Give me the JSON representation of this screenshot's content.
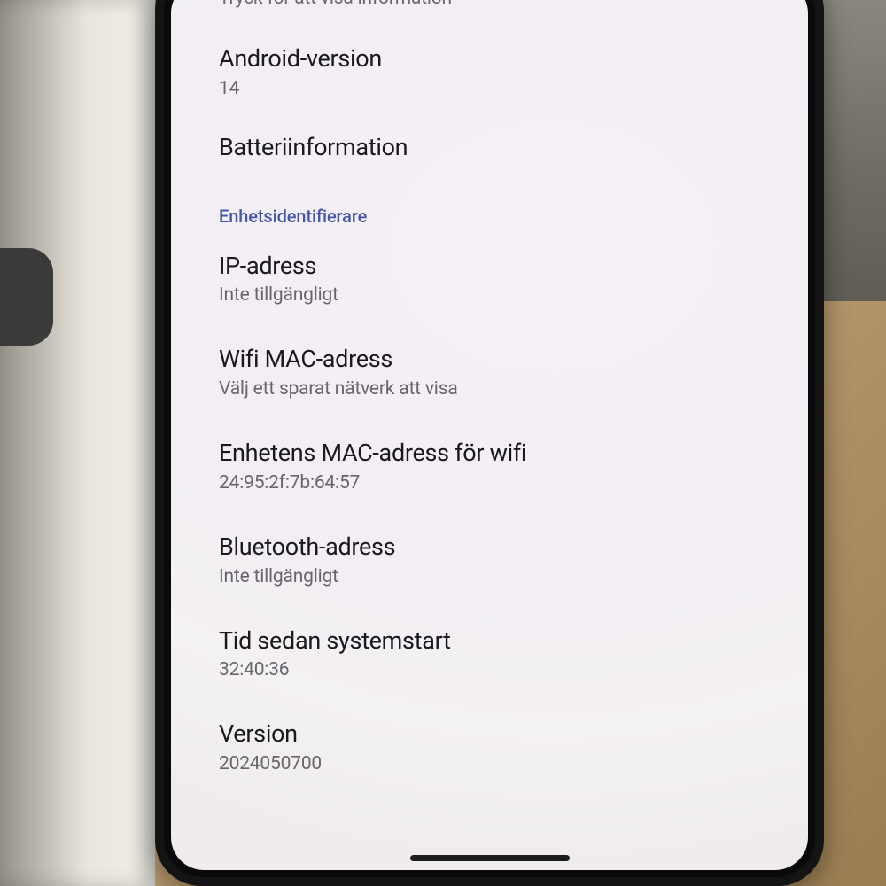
{
  "top": {
    "hint": "Tryck för att visa information"
  },
  "items": {
    "android_version": {
      "title": "Android-version",
      "value": "14"
    },
    "battery_info": {
      "title": "Batteriinformation"
    }
  },
  "section": {
    "device_identifiers": "Enhetsidentifierare"
  },
  "identifiers": {
    "ip": {
      "title": "IP-adress",
      "value": "Inte tillgängligt"
    },
    "wifi_mac": {
      "title": "Wifi MAC-adress",
      "value": "Välj ett sparat nätverk att visa"
    },
    "device_wifi_mac": {
      "title": "Enhetens MAC-adress för wifi",
      "value": "24:95:2f:7b:64:57"
    },
    "bluetooth": {
      "title": "Bluetooth-adress",
      "value": "Inte tillgängligt"
    },
    "uptime": {
      "title": "Tid sedan systemstart",
      "value": "32:40:36"
    },
    "version": {
      "title": "Version",
      "value": "2024050700"
    }
  }
}
